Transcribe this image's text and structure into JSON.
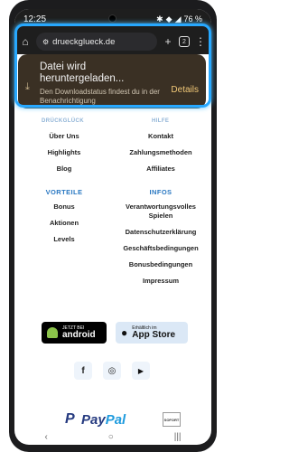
{
  "status": {
    "time": "12:25",
    "battery": "76 %"
  },
  "browser": {
    "url": "drueckglueck.de",
    "tab_count": "2"
  },
  "download_popup": {
    "title": "Datei wird heruntergeladen...",
    "subtitle": "Den Downloadstatus findest du in der Benachrichtigung",
    "action": "Details"
  },
  "footer": {
    "left_partial_heading": "DRÜCKGLÜCK",
    "right_partial_heading": "HILFE",
    "left_links": [
      "Über Uns",
      "Highlights",
      "Blog"
    ],
    "right_links": [
      "Kontakt",
      "Zahlungsmethoden",
      "Affiliates"
    ],
    "vorteile": {
      "heading": "VORTEILE",
      "links": [
        "Bonus",
        "Aktionen",
        "Levels"
      ]
    },
    "infos": {
      "heading": "INFOS",
      "links": [
        "Verantwortungsvolles Spielen",
        "Datenschutzerklärung",
        "Geschäftsbedingungen",
        "Bonusbedingungen",
        "Impressum"
      ]
    }
  },
  "stores": {
    "android": {
      "small": "JETZT BEI",
      "big": "android"
    },
    "apple": {
      "small": "Erhältlich im",
      "big": "App Store"
    }
  },
  "social": {
    "facebook": "f",
    "instagram": "◎",
    "youtube": "▶"
  },
  "payments": {
    "paypal_pay": "Pay",
    "paypal_pal": "Pal",
    "sofort": "SOFORT"
  },
  "colors": {
    "accent": "#2a78c2",
    "popup_bg": "#3a3024",
    "details": "#f0c777",
    "highlight": "#27a8ff"
  }
}
